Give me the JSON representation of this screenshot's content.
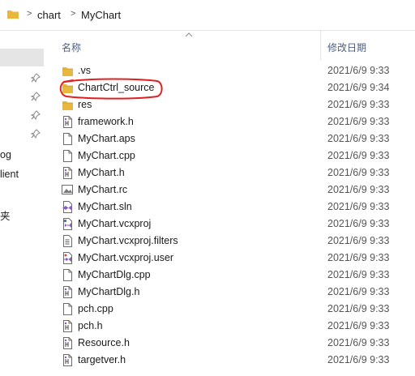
{
  "address": {
    "crumbs": [
      "chart",
      "MyChart"
    ],
    "separator": ">"
  },
  "nav": {
    "items": [
      "og",
      "lient",
      "夹"
    ]
  },
  "columns": {
    "name": "名称",
    "date": "修改日期"
  },
  "files": [
    {
      "name": ".vs",
      "date": "2021/6/9 9:33",
      "icon": "folder-icon"
    },
    {
      "name": "ChartCtrl_source",
      "date": "2021/6/9 9:34",
      "icon": "folder-icon"
    },
    {
      "name": "res",
      "date": "2021/6/9 9:33",
      "icon": "folder-icon"
    },
    {
      "name": "framework.h",
      "date": "2021/6/9 9:33",
      "icon": "header-file-icon"
    },
    {
      "name": "MyChart.aps",
      "date": "2021/6/9 9:33",
      "icon": "file-icon"
    },
    {
      "name": "MyChart.cpp",
      "date": "2021/6/9 9:33",
      "icon": "file-icon"
    },
    {
      "name": "MyChart.h",
      "date": "2021/6/9 9:33",
      "icon": "header-file-icon"
    },
    {
      "name": "MyChart.rc",
      "date": "2021/6/9 9:33",
      "icon": "resource-file-icon"
    },
    {
      "name": "MyChart.sln",
      "date": "2021/6/9 9:33",
      "icon": "solution-file-icon"
    },
    {
      "name": "MyChart.vcxproj",
      "date": "2021/6/9 9:33",
      "icon": "project-file-icon"
    },
    {
      "name": "MyChart.vcxproj.filters",
      "date": "2021/6/9 9:33",
      "icon": "filters-file-icon"
    },
    {
      "name": "MyChart.vcxproj.user",
      "date": "2021/6/9 9:33",
      "icon": "user-file-icon"
    },
    {
      "name": "MyChartDlg.cpp",
      "date": "2021/6/9 9:33",
      "icon": "file-icon"
    },
    {
      "name": "MyChartDlg.h",
      "date": "2021/6/9 9:33",
      "icon": "header-file-icon"
    },
    {
      "name": "pch.cpp",
      "date": "2021/6/9 9:33",
      "icon": "file-icon"
    },
    {
      "name": "pch.h",
      "date": "2021/6/9 9:33",
      "icon": "header-file-icon"
    },
    {
      "name": "Resource.h",
      "date": "2021/6/9 9:33",
      "icon": "header-file-icon"
    },
    {
      "name": "targetver.h",
      "date": "2021/6/9 9:33",
      "icon": "header-file-icon"
    }
  ],
  "colors": {
    "folder": "#e8b73c",
    "annotation": "#e02020",
    "selection": "#e5e5e5",
    "header_text": "#4d6082"
  }
}
